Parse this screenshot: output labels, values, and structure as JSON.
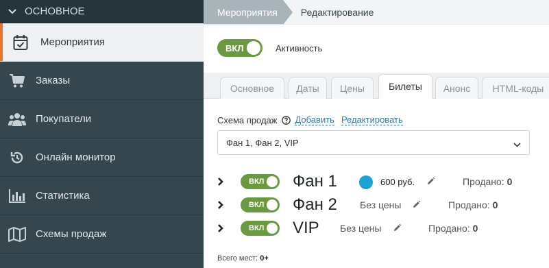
{
  "sidebar": {
    "section_title": "ОСНОВНОЕ",
    "items": [
      {
        "label": "Мероприятия",
        "icon": "calendar-check-icon",
        "active": true
      },
      {
        "label": "Заказы",
        "icon": "cart-icon"
      },
      {
        "label": "Покупатели",
        "icon": "users-icon"
      },
      {
        "label": "Онлайн монитор",
        "icon": "history-icon"
      },
      {
        "label": "Статистика",
        "icon": "bar-chart-icon"
      },
      {
        "label": "Схемы продаж",
        "icon": "map-icon"
      }
    ]
  },
  "breadcrumb": {
    "parent": "Мероприятия",
    "current": "Редактирование"
  },
  "activity": {
    "toggle_label": "ВКЛ",
    "label": "Активность"
  },
  "tabs": [
    {
      "label": "Основное"
    },
    {
      "label": "Даты"
    },
    {
      "label": "Цены"
    },
    {
      "label": "Билеты",
      "active": true
    },
    {
      "label": "Анонс"
    },
    {
      "label": "HTML-коды"
    }
  ],
  "schema": {
    "label": "Схема продаж",
    "add_link": "Добавить",
    "edit_link": "Редактировать",
    "selected": "Фан 1, Фан 2, VIP"
  },
  "ticket_rows": [
    {
      "toggle": "ВКЛ",
      "name": "Фан 1",
      "price": "600 руб.",
      "price_color": "#1aa3d3",
      "sold_label": "Продано:",
      "sold": "0"
    },
    {
      "toggle": "ВКЛ",
      "name": "Фан 2",
      "price": "Без цены",
      "sold_label": "Продано:",
      "sold": "0"
    },
    {
      "toggle": "ВКЛ",
      "name": "VIP",
      "price": "Без цены",
      "sold_label": "Продано:",
      "sold": "0"
    }
  ],
  "total": {
    "label": "Всего мест:",
    "value": "0+"
  },
  "colors": {
    "accent": "#e8742d",
    "toggle_on": "#6a9a3f",
    "sidebar": "#35464f",
    "link": "#3578a8"
  }
}
